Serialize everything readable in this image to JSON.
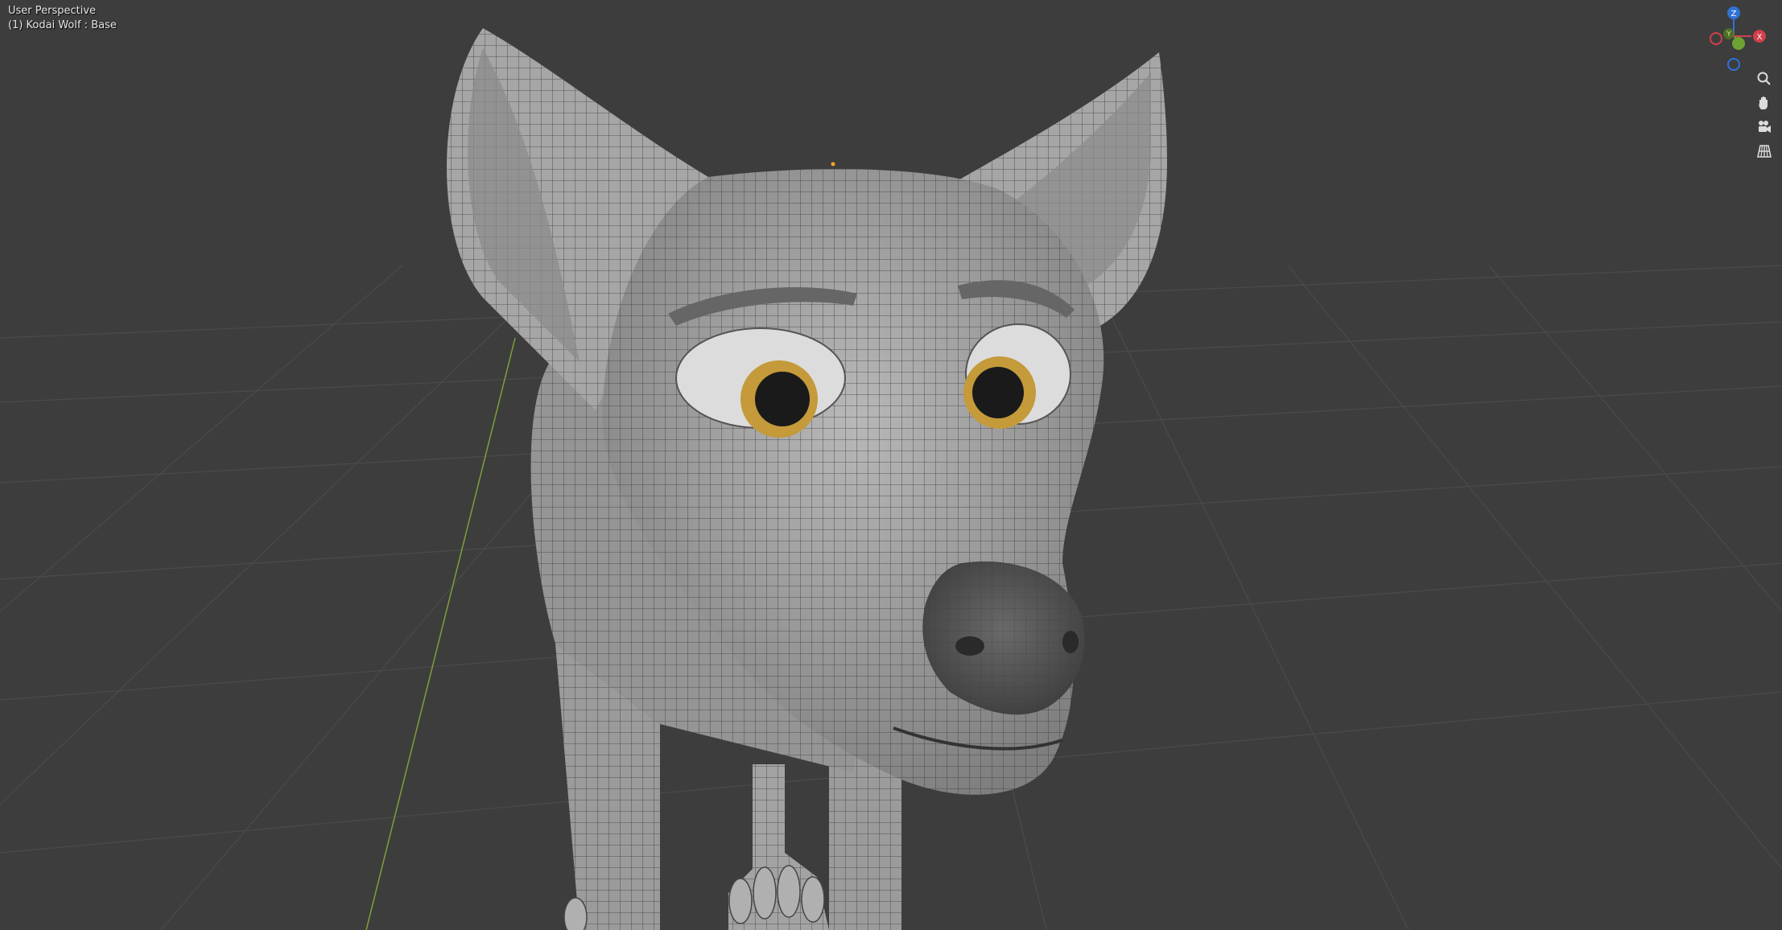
{
  "viewport": {
    "view_mode": "User Perspective",
    "object_info": "(1) Kodai Wolf : Base"
  },
  "gizmo": {
    "axes": [
      {
        "label": "Z",
        "color": "#2f72d6"
      },
      {
        "label": "Y",
        "color": "#6ea232"
      },
      {
        "label": "X",
        "color": "#d2404c"
      }
    ]
  },
  "nav_buttons": [
    {
      "name": "zoom-button",
      "icon": "magnifier-icon"
    },
    {
      "name": "pan-button",
      "icon": "hand-icon"
    },
    {
      "name": "camera-view-button",
      "icon": "camera-icon"
    },
    {
      "name": "ortho-toggle-button",
      "icon": "grid-icon"
    }
  ],
  "colors": {
    "background": "#3d3d3d",
    "grid": "#4a4a4a",
    "y_axis_line": "#7da03a",
    "mesh": "#9a9a9a",
    "eye_iris": "#c49a3a"
  }
}
